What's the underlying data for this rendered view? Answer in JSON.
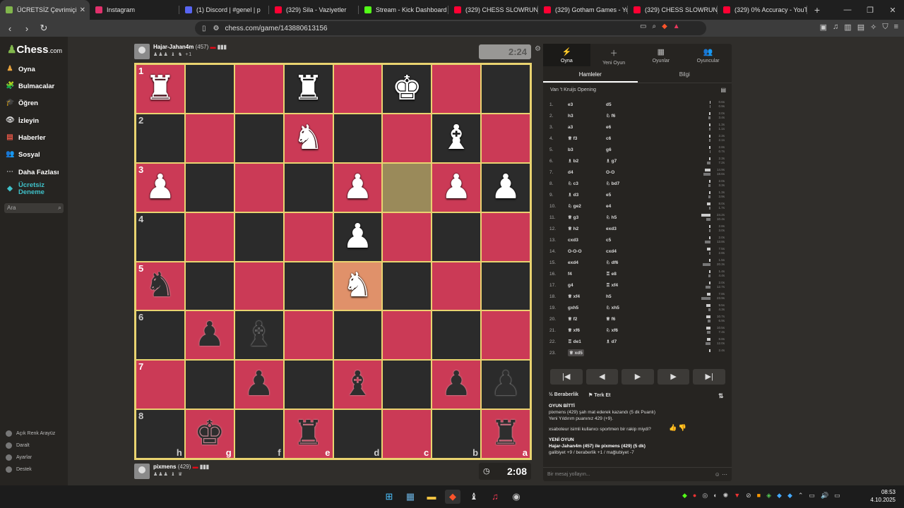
{
  "browser": {
    "tabs": [
      {
        "label": "ÜCRETSİZ Çevrimiçi",
        "color": "#81b64c",
        "active": true
      },
      {
        "label": "Instagram",
        "color": "#e1306c"
      },
      {
        "label": "(1) Discord | #genel | p",
        "color": "#5865f2"
      },
      {
        "label": "(329) Sila - Vaziyetler",
        "color": "#ff0033"
      },
      {
        "label": "Stream - Kick Dashboard",
        "color": "#53fc18"
      },
      {
        "label": "(329) CHESS SLOWRUN E",
        "color": "#ff0033"
      },
      {
        "label": "(329) Gotham Games - Yo",
        "color": "#ff0033"
      },
      {
        "label": "(329) CHESS SLOWRUN (l",
        "color": "#ff0033"
      },
      {
        "label": "(329) 0% Accuracy - YouTu",
        "color": "#ff0033"
      }
    ],
    "url": "chess.com/game/143880613156"
  },
  "sidebar": {
    "logo_main": "Chess",
    "logo_suffix": ".com",
    "items": [
      {
        "label": "Oyna",
        "color": "#e8a33d"
      },
      {
        "label": "Bulmacalar",
        "color": "#f08a24"
      },
      {
        "label": "Öğren",
        "color": "#4aa3df"
      },
      {
        "label": "İzleyin",
        "color": "#dddddd"
      },
      {
        "label": "Haberler",
        "color": "#e05545"
      },
      {
        "label": "Sosyal",
        "color": "#e8a33d"
      },
      {
        "label": "Daha Fazlası",
        "color": "#aaaaaa"
      },
      {
        "label": "Ücretsiz Deneme",
        "color": "#3fc1c9"
      }
    ],
    "search_placeholder": "Ara",
    "footer": [
      "Açık Renk Arayüz",
      "Daralt",
      "Ayarlar",
      "Destek"
    ]
  },
  "top_player": {
    "name": "Hajar-Jahan4m",
    "rating": "(457)",
    "captured": "♟♟♟ ♝ ♞ +1",
    "clock": "2:24"
  },
  "bottom_player": {
    "name": "pixmens",
    "rating": "(429)",
    "captured": "♟♟♟ ♝ ♛",
    "clock": "2:08"
  },
  "board": {
    "ranks": [
      "1",
      "2",
      "3",
      "4",
      "5",
      "6",
      "7",
      "8"
    ],
    "files": [
      "h",
      "g",
      "f",
      "e",
      "d",
      "c",
      "b",
      "a"
    ],
    "rows": [
      [
        "wR",
        "",
        "",
        "wR",
        "",
        "wK",
        "",
        ""
      ],
      [
        "",
        "",
        "",
        "wN",
        "",
        "",
        "wB",
        ""
      ],
      [
        "wP",
        "",
        "",
        "",
        "wP",
        "",
        "wP",
        "wP"
      ],
      [
        "",
        "",
        "",
        "",
        "wP",
        "",
        "",
        ""
      ],
      [
        "bN",
        "",
        "",
        "",
        "wN",
        "",
        "",
        ""
      ],
      [
        "",
        "bP",
        "bB",
        "",
        "",
        "",
        "",
        ""
      ],
      [
        "",
        "",
        "bP",
        "",
        "bB",
        "",
        "bP",
        "bP"
      ],
      [
        "",
        "bK",
        "",
        "bR",
        "",
        "",
        "",
        "bR"
      ]
    ],
    "highlight": [
      2,
      5
    ],
    "lastmove": [
      4,
      4
    ]
  },
  "panel": {
    "tabs": [
      {
        "label": "Oyna",
        "icon": "⚡"
      },
      {
        "label": "Yeni Oyun",
        "icon": "＋"
      },
      {
        "label": "Oyunlar",
        "icon": "▦"
      },
      {
        "label": "Oyuncular",
        "icon": "👥"
      }
    ],
    "subtabs": [
      "Hamleler",
      "Bilgi"
    ],
    "opening": "Van 't Kruijs Opening",
    "moves": [
      [
        "1.",
        "e3",
        "d5",
        "0.6s",
        "0.9s"
      ],
      [
        "2.",
        "h3",
        "♘ f6",
        "2.0s",
        "3.4s"
      ],
      [
        "3.",
        "a3",
        "e6",
        "1.3s",
        "1.1s"
      ],
      [
        "4.",
        "♕ f3",
        "c6",
        "2.3s",
        "2.1s"
      ],
      [
        "5.",
        "b3",
        "g6",
        "2.8s",
        "0.7s"
      ],
      [
        "6.",
        "♗ b2",
        "♗ g7",
        "2.3s",
        "7.2s"
      ],
      [
        "7.",
        "d4",
        "O-O",
        "14.9s",
        "18.6s"
      ],
      [
        "8.",
        "♘ c3",
        "♘ bd7",
        "2.0s",
        "3.3s"
      ],
      [
        "9.",
        "♗ d3",
        "e5",
        "1.3s",
        "3.9s"
      ],
      [
        "10.",
        "♘ ge2",
        "e4",
        "8.0s",
        "1.7s"
      ],
      [
        "11.",
        "♕ g3",
        "♘ h5",
        "24.2s",
        "10.4s"
      ],
      [
        "12.",
        "♕ h2",
        "exd3",
        "2.8s",
        "3.0s"
      ],
      [
        "13.",
        "cxd3",
        "c5",
        "2.0s",
        "13.8s"
      ],
      [
        "14.",
        "O-O-O",
        "cxd4",
        "7.5s",
        "2.8s"
      ],
      [
        "15.",
        "exd4",
        "♘ df6",
        "1.5s",
        "20.3s"
      ],
      [
        "16.",
        "f4",
        "♖ e8",
        "1.4s",
        "4.4s"
      ],
      [
        "17.",
        "g4",
        "♖ xf4",
        "2.0s",
        "12.7s"
      ],
      [
        "18.",
        "♕ xf4",
        "h5",
        "7.8s",
        "23.9s"
      ],
      [
        "19.",
        "gxh5",
        "♘ xh5",
        "9.5s",
        "4.3s"
      ],
      [
        "20.",
        "♕ f2",
        "♕ f6",
        "10.7s",
        "6.9s"
      ],
      [
        "21.",
        "♕ xf6",
        "♘ xf6",
        "10.5s",
        "7.4s"
      ],
      [
        "22.",
        "♖ de1",
        "♗ d7",
        "8.8s",
        "12.0s"
      ],
      [
        "23.",
        "♕ xd5",
        "",
        "2.4s",
        ""
      ]
    ],
    "controls": [
      "|◀",
      "◀",
      "▶",
      "▶",
      "▶|"
    ],
    "draw_label": "Beraberlik",
    "resign_label": "Terk Et",
    "chat": {
      "over_title": "OYUN BİTTİ",
      "over_line1": "pixmens (429) şah mat ederek kazandı (5 dk Puanlı)",
      "over_line2": "Yeni Yıldırım puanınız 429 (+9).",
      "question": "xsaboteur isimli kullanıcı sportmen bir rakip miydi?",
      "new_title": "YENİ OYUN",
      "new_line1": "Hajar-Jahan4m (457) ile pixmens (429) (5 dk)",
      "new_line2": "galibiyet +9 / beraberlik +1 / mağlubiyet -7"
    },
    "chat_placeholder": "Bir mesaj yollayın..."
  },
  "taskbar": {
    "time": "08:53",
    "date": "4.10.2025"
  }
}
